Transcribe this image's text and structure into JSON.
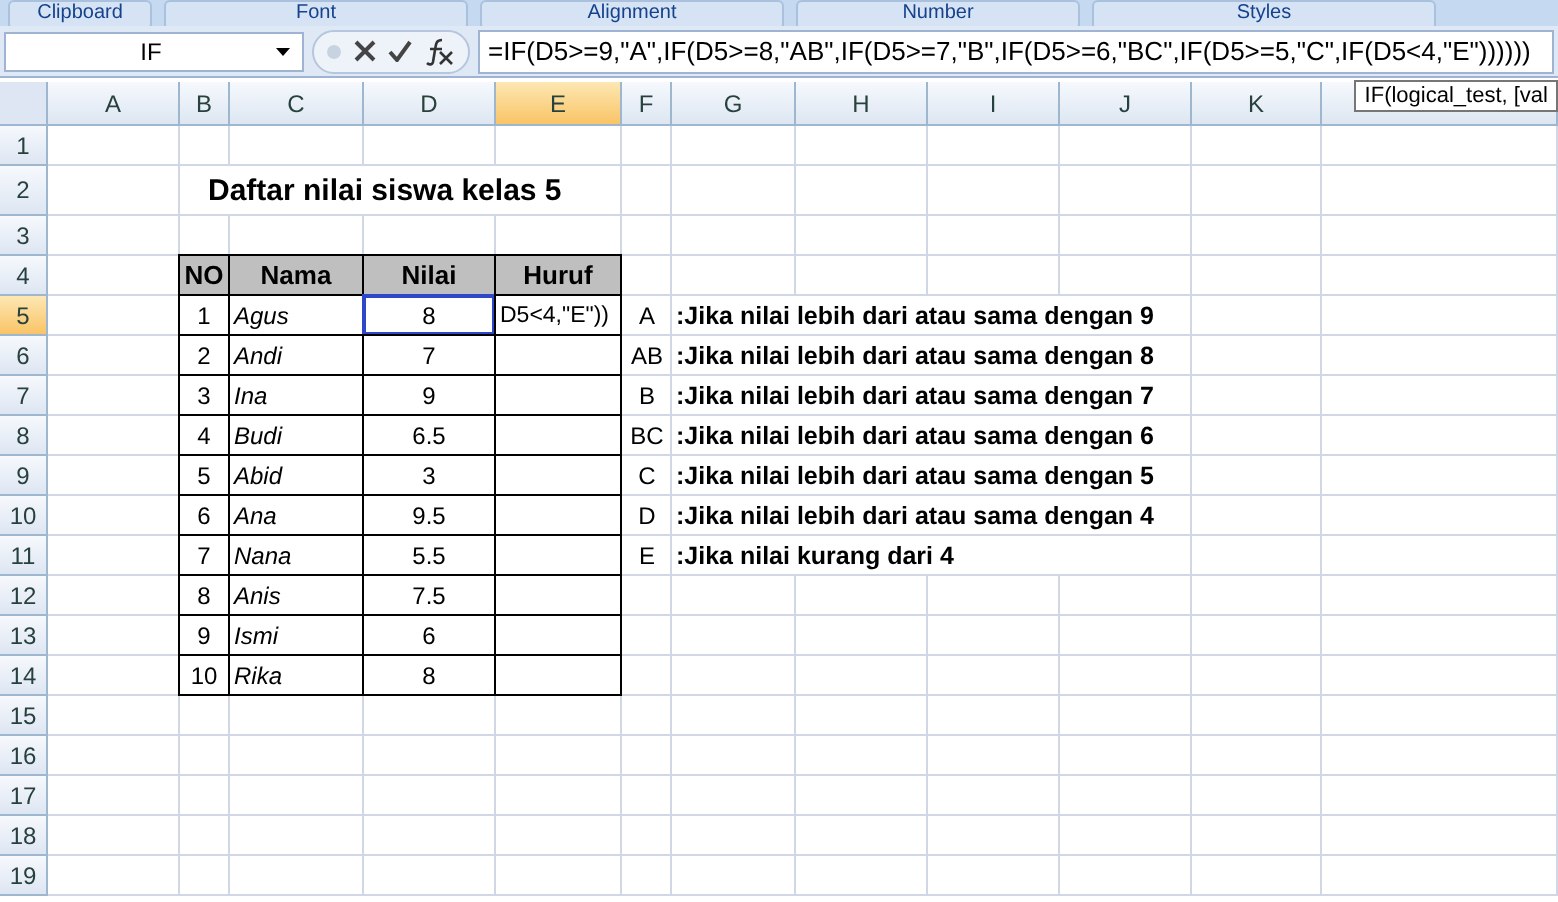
{
  "ribbon_groups": [
    "Clipboard",
    "Font",
    "Alignment",
    "Number",
    "Styles"
  ],
  "name_box": "IF",
  "formula": "=IF(D5>=9,\"A\",IF(D5>=8,\"AB\",IF(D5>=7,\"B\",IF(D5>=6,\"BC\",IF(D5>=5,\"C\",IF(D5<4,\"E\"))))))",
  "tooltip": "IF(logical_test, [val",
  "columns": [
    {
      "label": "A",
      "selected": false
    },
    {
      "label": "B",
      "selected": false
    },
    {
      "label": "C",
      "selected": false
    },
    {
      "label": "D",
      "selected": false
    },
    {
      "label": "E",
      "selected": true
    },
    {
      "label": "F",
      "selected": false
    },
    {
      "label": "G",
      "selected": false
    },
    {
      "label": "H",
      "selected": false
    },
    {
      "label": "I",
      "selected": false
    },
    {
      "label": "J",
      "selected": false
    },
    {
      "label": "K",
      "selected": false
    }
  ],
  "rows": [
    {
      "label": "1",
      "selected": false
    },
    {
      "label": "2",
      "selected": false
    },
    {
      "label": "3",
      "selected": false
    },
    {
      "label": "4",
      "selected": false
    },
    {
      "label": "5",
      "selected": true
    },
    {
      "label": "6",
      "selected": false
    },
    {
      "label": "7",
      "selected": false
    },
    {
      "label": "8",
      "selected": false
    },
    {
      "label": "9",
      "selected": false
    },
    {
      "label": "10",
      "selected": false
    },
    {
      "label": "11",
      "selected": false
    },
    {
      "label": "12",
      "selected": false
    },
    {
      "label": "13",
      "selected": false
    },
    {
      "label": "14",
      "selected": false
    },
    {
      "label": "15",
      "selected": false
    },
    {
      "label": "16",
      "selected": false
    },
    {
      "label": "17",
      "selected": false
    },
    {
      "label": "18",
      "selected": false
    },
    {
      "label": "19",
      "selected": false
    }
  ],
  "title": "Daftar nilai siswa kelas 5",
  "table": {
    "columns": [
      "NO",
      "Nama",
      "Nilai",
      "Huruf"
    ],
    "rows": [
      {
        "no": "1",
        "nama": "Agus",
        "nilai": "8",
        "referenced": true,
        "huruf": "D5<4,\"E\"))"
      },
      {
        "no": "2",
        "nama": "Andi",
        "nilai": "7",
        "referenced": false
      },
      {
        "no": "3",
        "nama": "Ina",
        "nilai": "9",
        "referenced": false
      },
      {
        "no": "4",
        "nama": "Budi",
        "nilai": "6.5",
        "referenced": false
      },
      {
        "no": "5",
        "nama": "Abid",
        "nilai": "3",
        "referenced": false
      },
      {
        "no": "6",
        "nama": "Ana",
        "nilai": "9.5",
        "referenced": false
      },
      {
        "no": "7",
        "nama": "Nana",
        "nilai": "5.5",
        "referenced": false
      },
      {
        "no": "8",
        "nama": "Anis",
        "nilai": "7.5",
        "referenced": false
      },
      {
        "no": "9",
        "nama": "Ismi",
        "nilai": "6",
        "referenced": false
      },
      {
        "no": "10",
        "nama": "Rika",
        "nilai": "8",
        "referenced": false
      }
    ]
  },
  "legend": [
    {
      "grade": "A",
      "rule": ":Jika nilai lebih dari atau sama dengan 9"
    },
    {
      "grade": "AB",
      "rule": ":Jika nilai lebih dari atau sama dengan 8"
    },
    {
      "grade": "B",
      "rule": ":Jika nilai lebih dari atau sama dengan 7"
    },
    {
      "grade": "BC",
      "rule": ":Jika nilai lebih dari atau sama dengan 6"
    },
    {
      "grade": "C",
      "rule": ":Jika nilai lebih dari atau sama dengan 5"
    },
    {
      "grade": "D",
      "rule": ":Jika nilai lebih dari atau sama dengan 4"
    },
    {
      "grade": "E",
      "rule": ":Jika nilai kurang dari 4"
    }
  ]
}
